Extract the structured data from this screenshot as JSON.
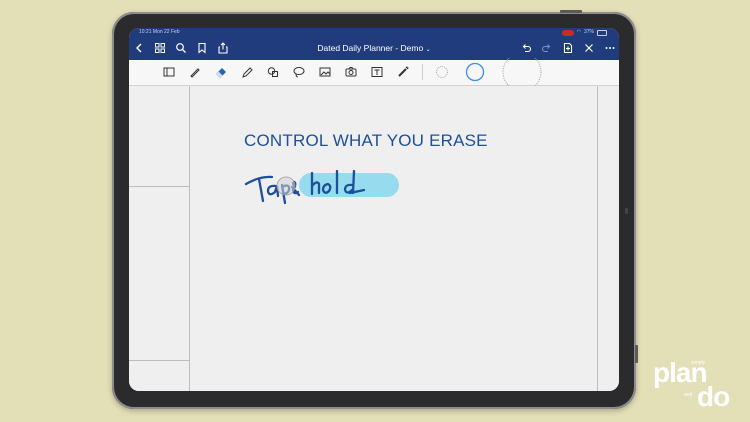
{
  "status_bar": {
    "left": "10:21  Mon 22 Feb",
    "battery": "37%"
  },
  "navbar": {
    "title": "Dated Daily Planner - Demo"
  },
  "toolbar": {
    "tools": [
      "sidebar-icon",
      "pen-icon",
      "eraser-icon",
      "highlighter-icon",
      "shapes-icon",
      "lasso-icon",
      "image-icon",
      "camera-icon",
      "text-icon",
      "laser-pointer-icon"
    ],
    "eraser_sizes": [
      "small",
      "medium",
      "large"
    ],
    "selected_eraser_size": "medium"
  },
  "page": {
    "heading": "CONTROL WHAT YOU ERASE",
    "handwriting": "Tap & hold",
    "accent_color": "#1d4f9a",
    "highlight_color": "#97dcee"
  },
  "logo": {
    "top_small": "simply",
    "word1": "plan",
    "mid_small": "and",
    "word2": "do"
  },
  "colors": {
    "background": "#e3dfb7",
    "navbar": "#203c7c",
    "device": "#2b2b2d"
  }
}
